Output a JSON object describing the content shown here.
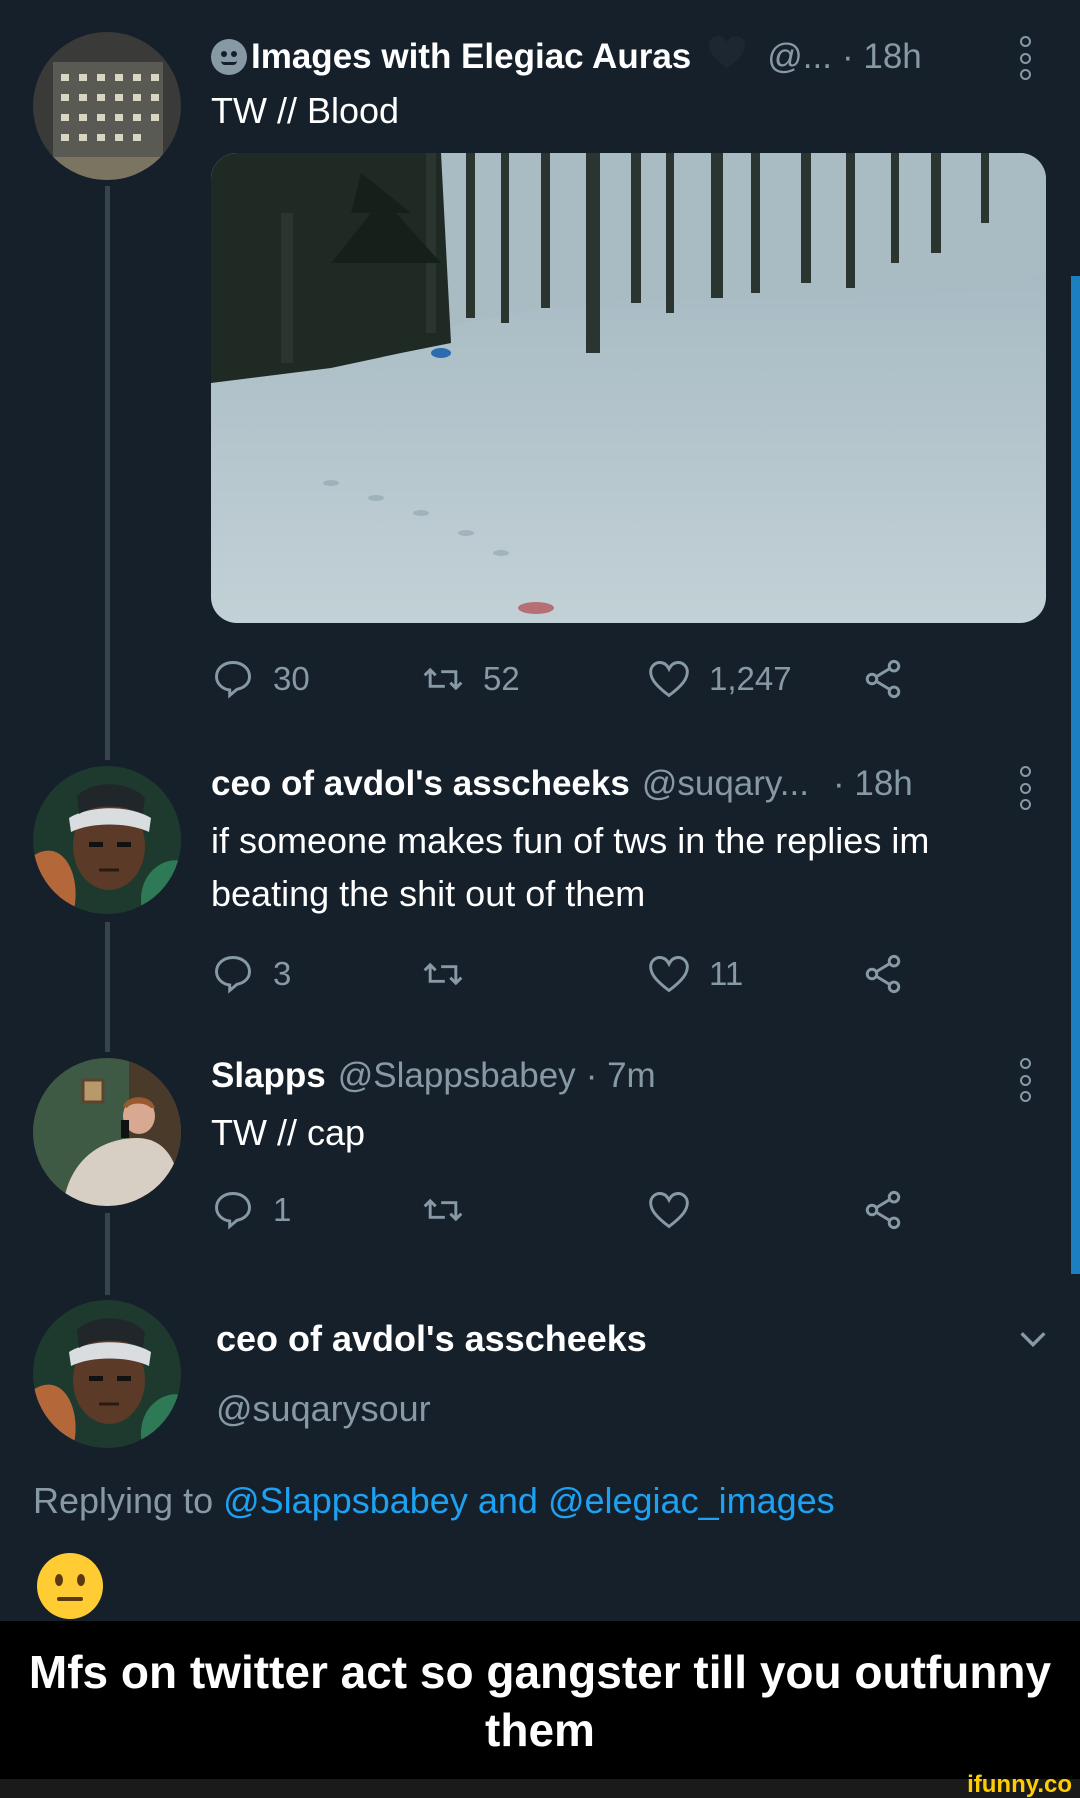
{
  "thread": {
    "tweet1": {
      "name": "Images with Elegiac Auras",
      "handle": "@...",
      "time": "· 18h",
      "text": "TW // Blood",
      "stats": {
        "replies": "30",
        "retweets": "52",
        "likes": "1,247"
      }
    },
    "tweet2": {
      "name": "ceo of avdol's asscheeks",
      "handle": "@suqary...",
      "time": "· 18h",
      "text": "if someone makes fun of tws in the replies im beating the shit out of them",
      "stats": {
        "replies": "3",
        "retweets": "",
        "likes": "11"
      }
    },
    "tweet3": {
      "name": "Slapps",
      "handle": "@Slappsbabey",
      "time": "· 7m",
      "text": "TW // cap",
      "stats": {
        "replies": "1",
        "retweets": "",
        "likes": ""
      }
    },
    "main": {
      "name": "ceo of avdol's asscheeks",
      "handle": "@suqarysour",
      "replying_prefix": "Replying to",
      "mention1": "@Slappsbabey",
      "and": "and",
      "mention2": "@elegiac_images"
    }
  },
  "caption": "Mfs on twitter act so gangster till you outfunny them",
  "watermark": "ifunny.co",
  "colors": {
    "background": "#15202b",
    "muted": "#8899a6",
    "link": "#1da1f2",
    "caption_bg": "#000000"
  }
}
